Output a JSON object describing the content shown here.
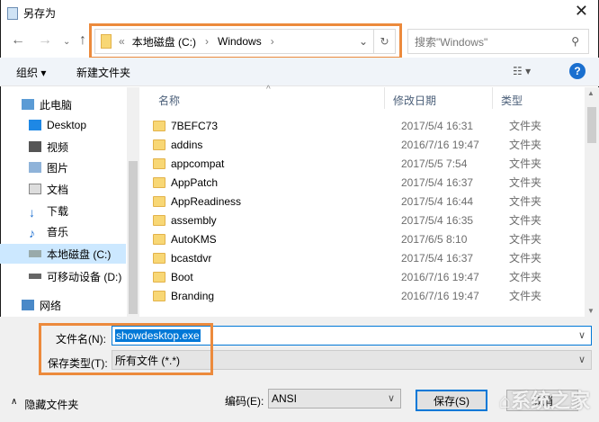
{
  "title": "另存为",
  "address": {
    "prefix": "«",
    "segments": [
      "本地磁盘 (C:)",
      "Windows"
    ]
  },
  "search": {
    "placeholder": "搜索\"Windows\""
  },
  "toolbar": {
    "organize": "组织 ▾",
    "new_folder": "新建文件夹"
  },
  "columns": {
    "name": "名称",
    "date": "修改日期",
    "type": "类型"
  },
  "sidebar": [
    {
      "label": "此电脑",
      "icon": "computer-icon"
    },
    {
      "label": "Desktop",
      "icon": "desktop-icon"
    },
    {
      "label": "视频",
      "icon": "video-icon"
    },
    {
      "label": "图片",
      "icon": "picture-icon"
    },
    {
      "label": "文档",
      "icon": "document-icon"
    },
    {
      "label": "下载",
      "icon": "download-icon"
    },
    {
      "label": "音乐",
      "icon": "music-icon"
    },
    {
      "label": "本地磁盘 (C:)",
      "icon": "drive-icon",
      "selected": true
    },
    {
      "label": "可移动设备 (D:)",
      "icon": "usb-drive-icon"
    },
    {
      "label": "网络",
      "icon": "network-icon"
    }
  ],
  "files": [
    {
      "name": "7BEFC73",
      "date": "2017/5/4 16:31",
      "type": "文件夹"
    },
    {
      "name": "addins",
      "date": "2016/7/16 19:47",
      "type": "文件夹"
    },
    {
      "name": "appcompat",
      "date": "2017/5/5 7:54",
      "type": "文件夹"
    },
    {
      "name": "AppPatch",
      "date": "2017/5/4 16:37",
      "type": "文件夹"
    },
    {
      "name": "AppReadiness",
      "date": "2017/5/4 16:44",
      "type": "文件夹"
    },
    {
      "name": "assembly",
      "date": "2017/5/4 16:35",
      "type": "文件夹"
    },
    {
      "name": "AutoKMS",
      "date": "2017/6/5 8:10",
      "type": "文件夹"
    },
    {
      "name": "bcastdvr",
      "date": "2017/5/4 16:37",
      "type": "文件夹"
    },
    {
      "name": "Boot",
      "date": "2016/7/16 19:47",
      "type": "文件夹"
    },
    {
      "name": "Branding",
      "date": "2016/7/16 19:47",
      "type": "文件夹"
    }
  ],
  "filename": {
    "label": "文件名(N):",
    "value": "showdesktop.exe"
  },
  "filetype": {
    "label": "保存类型(T):",
    "value": "所有文件  (*.*)"
  },
  "encoding": {
    "label": "编码(E):",
    "value": "ANSI"
  },
  "hide_folders": "隐藏文件夹",
  "buttons": {
    "save": "保存(S)",
    "cancel": "取消"
  },
  "watermark": "系统之家",
  "accent": "#ec8a3c"
}
